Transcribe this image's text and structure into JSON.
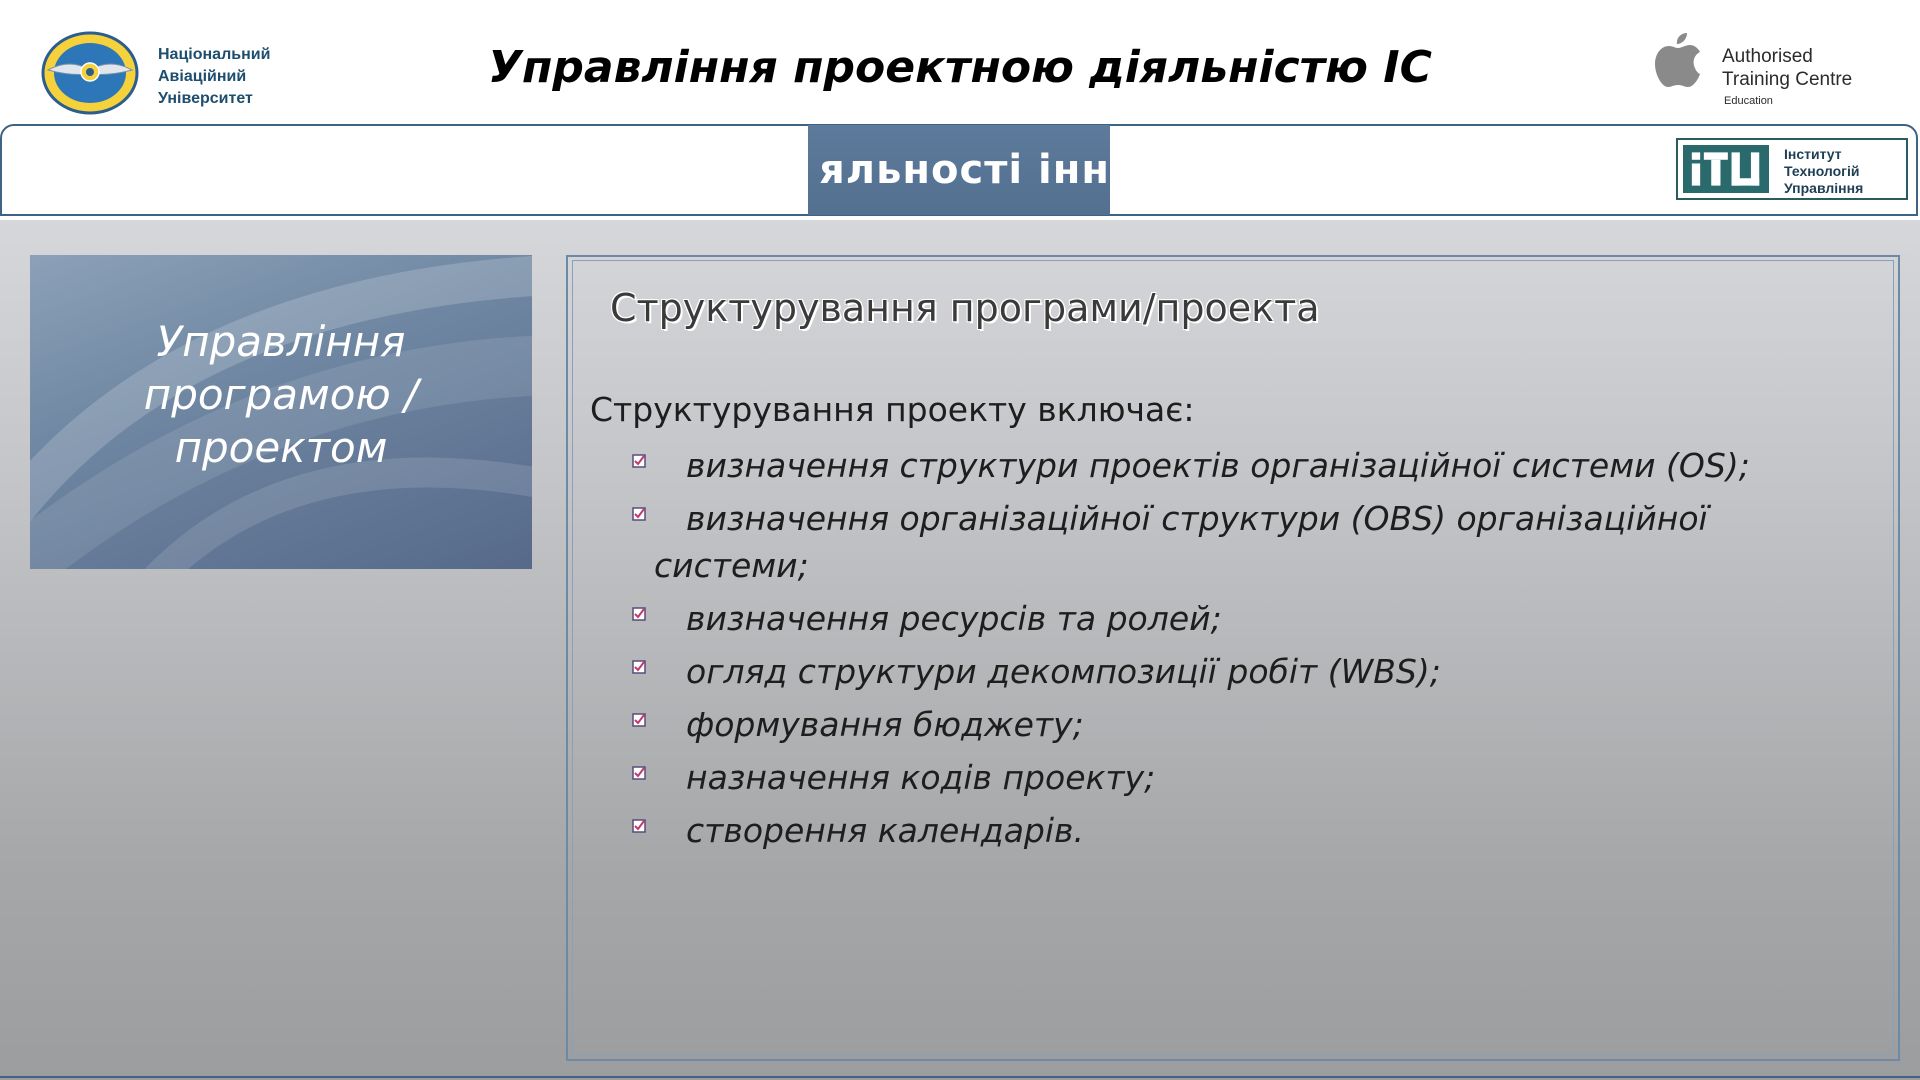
{
  "header": {
    "university_lines": [
      "Національний",
      "Авіаційний",
      "Університет"
    ],
    "main_title": "Управління проектною діяльністю ІС",
    "atc": {
      "line1": "Authorised",
      "line2": "Training Centre",
      "line3": "Education"
    }
  },
  "banner": {
    "visible_text": "яльності інн",
    "itu_lines": [
      "Інститут",
      "Технологій",
      "Управління"
    ]
  },
  "section": {
    "title_lines": [
      "Управління",
      "програмою /",
      "проектом"
    ]
  },
  "content": {
    "heading": "Структурування програми/проекта",
    "intro": "Структурування проекту включає:",
    "bullets": [
      "визначення структури проектів організаційної системи (OS);",
      "визначення організаційної структури (OBS) організаційної",
      "визначення ресурсів та ролей;",
      "огляд структури декомпозиції робіт (WBS);",
      "формування бюджету;",
      "назначення кодів проекту;",
      "створення календарів."
    ],
    "bullet2_continuation": "системи;"
  },
  "colors": {
    "accent_border": "#3f6385",
    "banner_fill": "#5d7a9c",
    "bullet_icon": "#c0396b"
  }
}
